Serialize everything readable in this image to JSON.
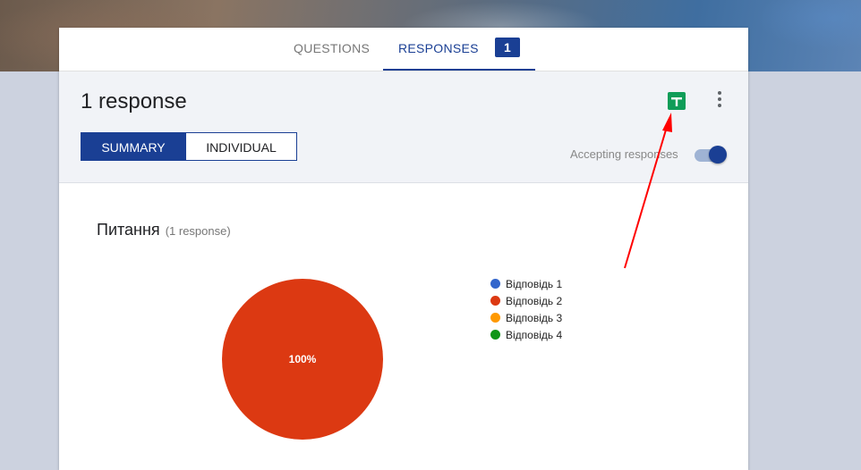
{
  "tabs": {
    "questions_label": "QUESTIONS",
    "responses_label": "RESPONSES",
    "responses_count": "1"
  },
  "header": {
    "title": "1 response",
    "sheets_icon": "google-sheets-icon",
    "more_icon": "more-vert-icon",
    "view_toggle": {
      "summary_label": "SUMMARY",
      "individual_label": "INDIVIDUAL",
      "selected": "SUMMARY"
    },
    "accepting_label": "Accepting responses",
    "accepting_enabled": true
  },
  "question": {
    "title": "Питання",
    "count_label": "(1 response)"
  },
  "chart_data": {
    "type": "pie",
    "categories": [
      "Відповідь 1",
      "Відповідь 2",
      "Відповідь 3",
      "Відповідь 4"
    ],
    "values": [
      0,
      100,
      0,
      0
    ],
    "colors": [
      "#3366cc",
      "#dc3912",
      "#ff9900",
      "#109618"
    ],
    "data_labels": [
      "",
      "100%",
      "",
      ""
    ],
    "legend_position": "right"
  },
  "colors": {
    "accent": "#1a3f94",
    "annotation_arrow": "#ff0000",
    "sheets_green": "#0f9d58"
  }
}
